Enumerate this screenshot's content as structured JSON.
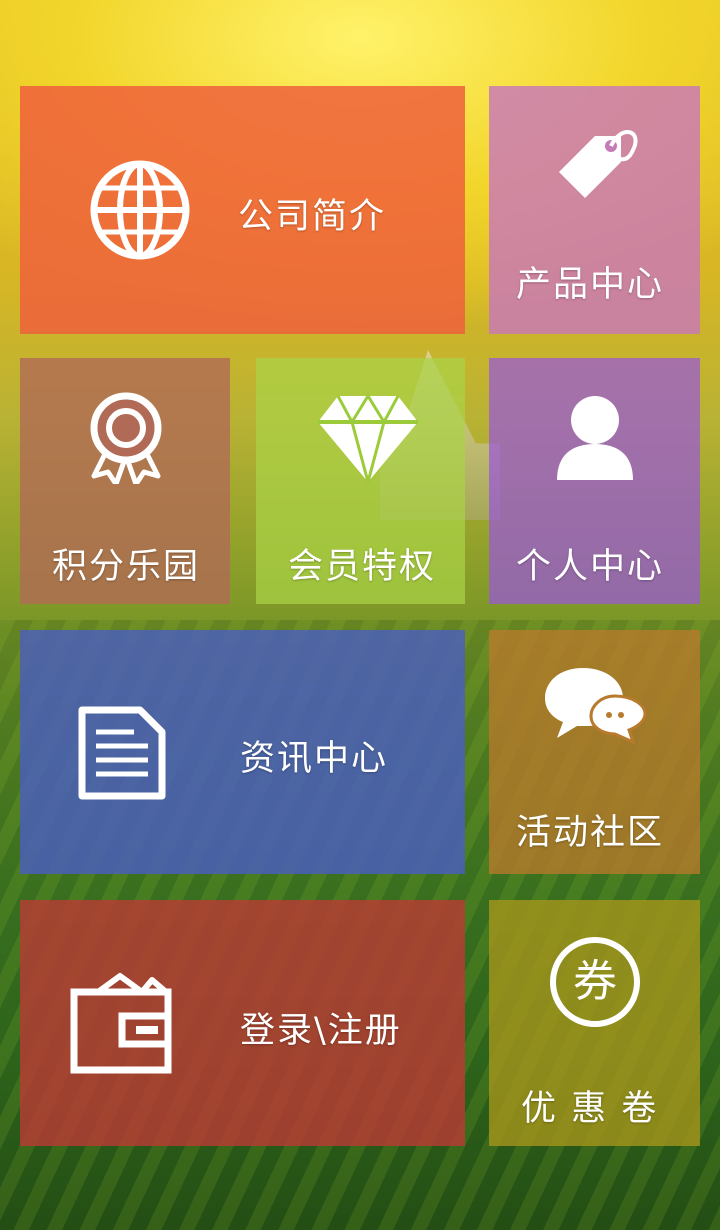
{
  "tiles": {
    "company": {
      "label": "公司简介",
      "icon": "globe-icon",
      "color": "#ee6a3c"
    },
    "products": {
      "label": "产品中心",
      "icon": "price-tag-icon",
      "color": "#c77ab8"
    },
    "points": {
      "label": "积分乐园",
      "icon": "award-ribbon-icon",
      "color": "#b06a55"
    },
    "vip": {
      "label": "会员特权",
      "icon": "diamond-icon",
      "color": "#9ccb3a"
    },
    "personal": {
      "label": "个人中心",
      "icon": "person-icon",
      "color": "#9a58d8"
    },
    "news": {
      "label": "资讯中心",
      "icon": "document-icon",
      "color": "#4a5ec0"
    },
    "community": {
      "label": "活动社区",
      "icon": "chat-bubbles-icon",
      "color": "#b87a2c"
    },
    "login": {
      "label": "登录\\注册",
      "icon": "wallet-icon",
      "color": "#b83a34"
    },
    "coupon": {
      "label": "优 惠 卷",
      "icon": "coupon-circle-icon",
      "icon_text": "券",
      "color": "#a8961c"
    }
  }
}
